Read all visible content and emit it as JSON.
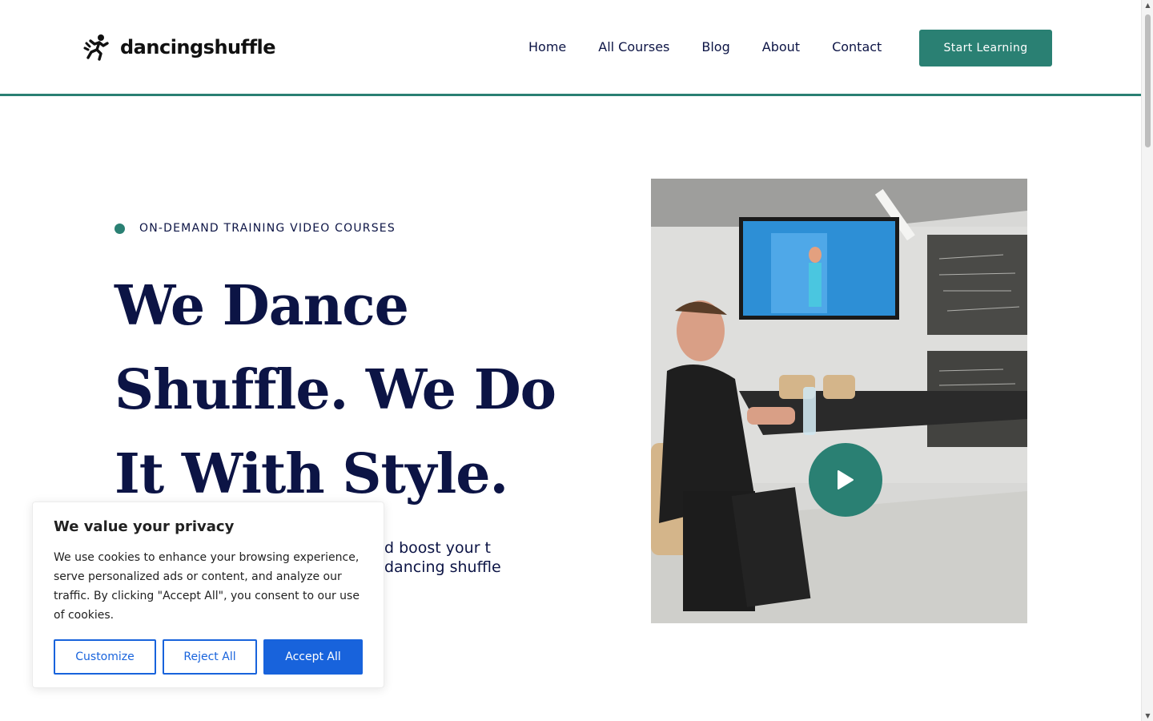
{
  "brand": {
    "name": "dancingshuffle"
  },
  "nav": {
    "items": [
      {
        "label": "Home"
      },
      {
        "label": "All Courses"
      },
      {
        "label": "Blog"
      },
      {
        "label": "About"
      },
      {
        "label": "Contact"
      }
    ],
    "cta_label": "Start Learning"
  },
  "hero": {
    "eyebrow": "ON-DEMAND TRAINING VIDEO COURSES",
    "title": "We Dance Shuffle. We Do It With Style.",
    "description_visible": "d boost your t dancing shuffle"
  },
  "cookie": {
    "title": "We value your privacy",
    "text": "We use cookies to enhance your browsing experience, serve personalized ads or content, and analyze our traffic. By clicking \"Accept All\", you consent to our use of cookies.",
    "customize_label": "Customize",
    "reject_label": "Reject All",
    "accept_label": "Accept All"
  },
  "icons": {
    "logo": "dancer-icon",
    "play": "play-icon"
  },
  "colors": {
    "accent": "#2a8073",
    "text": "#0c1445",
    "cookie_blue": "#1863dc"
  }
}
